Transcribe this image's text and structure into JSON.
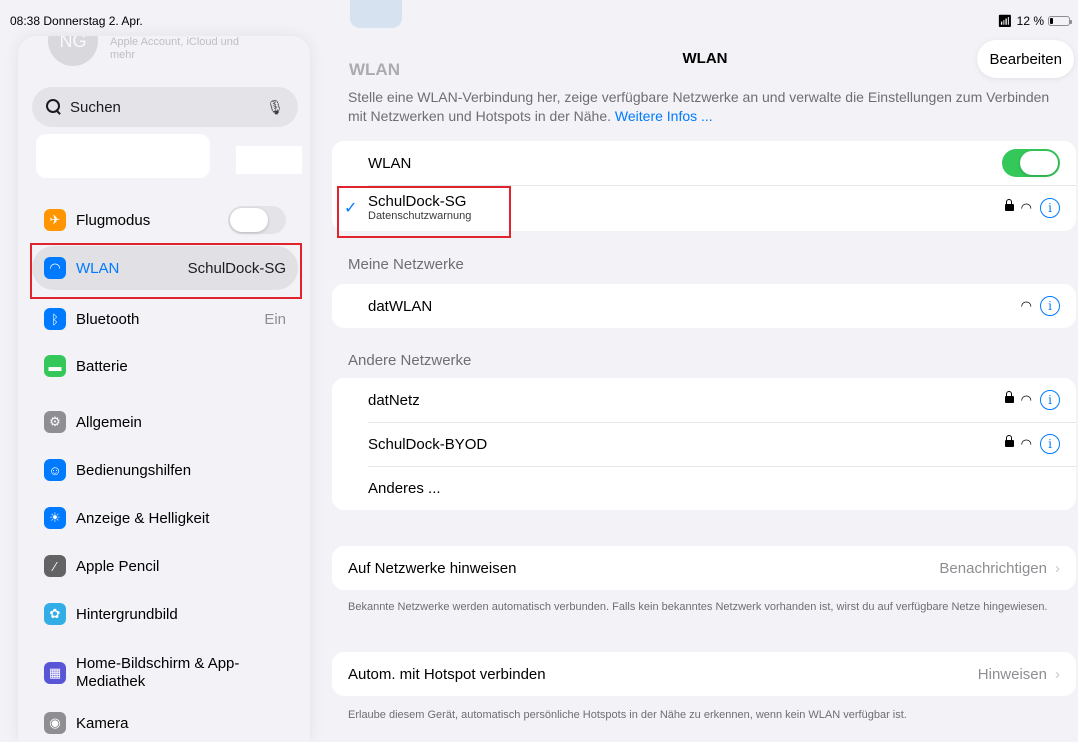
{
  "status": {
    "time_date": "08:38  Donnerstag 2. Apr.",
    "battery": "12 %"
  },
  "sidebar": {
    "account_initials": "NG",
    "account_sub": "Apple Account, iCloud und mehr",
    "search_placeholder": "Suchen",
    "items": [
      {
        "label": "Flugmodus",
        "value": "",
        "icon_color": "#ff9500",
        "icon": "airplane-icon"
      },
      {
        "label": "WLAN",
        "value": "SchulDock-SG",
        "icon_color": "#007aff",
        "icon": "wifi-icon"
      },
      {
        "label": "Bluetooth",
        "value": "Ein",
        "icon_color": "#007aff",
        "icon": "bluetooth-icon"
      },
      {
        "label": "Batterie",
        "value": "",
        "icon_color": "#34c759",
        "icon": "battery-icon"
      },
      {
        "label": "Allgemein",
        "value": "",
        "icon_color": "#8e8e93",
        "icon": "gear-icon"
      },
      {
        "label": "Bedienungshilfen",
        "value": "",
        "icon_color": "#007aff",
        "icon": "accessibility-icon"
      },
      {
        "label": "Anzeige & Helligkeit",
        "value": "",
        "icon_color": "#007aff",
        "icon": "brightness-icon"
      },
      {
        "label": "Apple Pencil",
        "value": "",
        "icon_color": "#636366",
        "icon": "pencil-icon"
      },
      {
        "label": "Hintergrundbild",
        "value": "",
        "icon_color": "#32ade6",
        "icon": "wallpaper-icon"
      },
      {
        "label": "Home-Bildschirm & App-Mediathek",
        "value": "",
        "icon_color": "#5856d6",
        "icon": "homescreen-icon"
      },
      {
        "label": "Kamera",
        "value": "",
        "icon_color": "#8e8e93",
        "icon": "camera-icon"
      }
    ]
  },
  "main": {
    "title": "WLAN",
    "edit_label": "Bearbeiten",
    "heading": "WLAN",
    "description": "Stelle eine WLAN-Verbindung her, zeige verfügbare Netzwerke an und verwalte die Einstellungen zum Verbinden mit Netzwerken und Hotspots in der Nähe.",
    "more_link": "Weitere Infos ...",
    "wlan_toggle_label": "WLAN",
    "wlan_on": true,
    "connected": {
      "name": "SchulDock-SG",
      "sub": "Datenschutzwarnung"
    },
    "my_networks_header": "Meine Netzwerke",
    "my_networks": [
      {
        "name": "datWLAN"
      }
    ],
    "other_networks_header": "Andere Netzwerke",
    "other_networks": [
      {
        "name": "datNetz"
      },
      {
        "name": "SchulDock-BYOD"
      }
    ],
    "other_label": "Anderes ...",
    "ask_join": {
      "label": "Auf Netzwerke hinweisen",
      "value": "Benachrichtigen"
    },
    "ask_join_footer": "Bekannte Netzwerke werden automatisch verbunden. Falls kein bekanntes Netzwerk vorhanden ist, wirst du auf verfügbare Netze hingewiesen.",
    "hotspot": {
      "label": "Autom. mit Hotspot verbinden",
      "value": "Hinweisen"
    },
    "hotspot_footer": "Erlaube diesem Gerät, automatisch persönliche Hotspots in der Nähe zu erkennen, wenn kein WLAN verfügbar ist."
  }
}
